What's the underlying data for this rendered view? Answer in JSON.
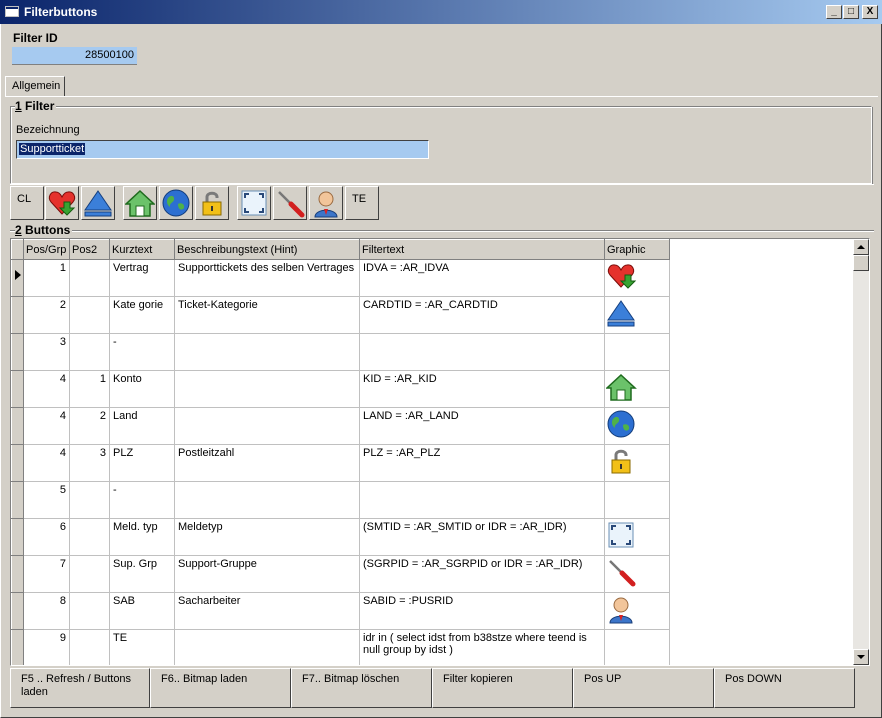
{
  "window": {
    "title": "Filterbuttons",
    "controls": {
      "minimize": "_",
      "maximize": "□",
      "close": "X"
    }
  },
  "filter_id": {
    "label": "Filter ID",
    "value": "28500100"
  },
  "tabs": [
    {
      "label": "Allgemein",
      "active": true
    }
  ],
  "filter_group": {
    "title_prefix": "1",
    "title": "Filter",
    "bezeichnung_label": "Bezeichnung",
    "bezeichnung_value": "Supportticket"
  },
  "toolbar": {
    "buttons": [
      {
        "label": "CL",
        "icon": "text"
      },
      {
        "label": "",
        "icon": "heart-down-icon"
      },
      {
        "label": "",
        "icon": "eject-triangle-icon"
      },
      {
        "label": "",
        "icon": "home-icon"
      },
      {
        "label": "",
        "icon": "globe-icon"
      },
      {
        "label": "",
        "icon": "padlock-icon"
      },
      {
        "label": "",
        "icon": "frame-corners-icon"
      },
      {
        "label": "",
        "icon": "screwdriver-icon"
      },
      {
        "label": "",
        "icon": "user-icon"
      },
      {
        "label": "TE",
        "icon": "text"
      }
    ]
  },
  "buttons_group": {
    "title_prefix": "2",
    "title": "Buttons"
  },
  "grid": {
    "columns": [
      "Pos/Grp",
      "Pos2",
      "Kurztext",
      "Beschreibungstext (Hint)",
      "Filtertext",
      "Graphic"
    ],
    "rows": [
      {
        "pos": "1",
        "pos2": "",
        "kurz": "Vertrag",
        "hint": "Supporttickets des selben Vertrages",
        "filter": "IDVA = :AR_IDVA",
        "icon": "heart-down-icon",
        "current": true
      },
      {
        "pos": "2",
        "pos2": "",
        "kurz": "Kate gorie",
        "hint": "Ticket-Kategorie",
        "filter": "CARDTID = :AR_CARDTID",
        "icon": "eject-triangle-icon"
      },
      {
        "pos": "3",
        "pos2": "",
        "kurz": "-",
        "hint": "",
        "filter": "",
        "icon": ""
      },
      {
        "pos": "4",
        "pos2": "1",
        "kurz": "Konto",
        "hint": "",
        "filter": "KID = :AR_KID",
        "icon": "home-icon"
      },
      {
        "pos": "4",
        "pos2": "2",
        "kurz": "Land",
        "hint": "",
        "filter": "LAND = :AR_LAND",
        "icon": "globe-icon"
      },
      {
        "pos": "4",
        "pos2": "3",
        "kurz": "PLZ",
        "hint": "Postleitzahl",
        "filter": "PLZ = :AR_PLZ",
        "icon": "padlock-icon"
      },
      {
        "pos": "5",
        "pos2": "",
        "kurz": "-",
        "hint": "",
        "filter": "",
        "icon": ""
      },
      {
        "pos": "6",
        "pos2": "",
        "kurz": "Meld. typ",
        "hint": "Meldetyp",
        "filter": "(SMTID = :AR_SMTID  or IDR = :AR_IDR)",
        "icon": "frame-corners-icon"
      },
      {
        "pos": "7",
        "pos2": "",
        "kurz": "Sup. Grp",
        "hint": "Support-Gruppe",
        "filter": "(SGRPID = :AR_SGRPID or IDR = :AR_IDR)",
        "icon": "screwdriver-icon"
      },
      {
        "pos": "8",
        "pos2": "",
        "kurz": "SAB",
        "hint": "Sacharbeiter",
        "filter": "SABID = :PUSRID",
        "icon": "user-icon"
      },
      {
        "pos": "9",
        "pos2": "",
        "kurz": "TE",
        "hint": "",
        "filter": "idr in ( select idst from b38stze where teend is null group by idst )",
        "icon": ""
      }
    ]
  },
  "footer_buttons": [
    "F5 .. Refresh / Buttons laden",
    "F6.. Bitmap laden",
    "F7.. Bitmap löschen",
    "Filter kopieren",
    "Pos UP",
    "Pos DOWN"
  ],
  "colors": {
    "title_start": "#0a246a",
    "title_end": "#a6caf0",
    "face": "#d4d0c8",
    "selection": "#a6caf0"
  }
}
